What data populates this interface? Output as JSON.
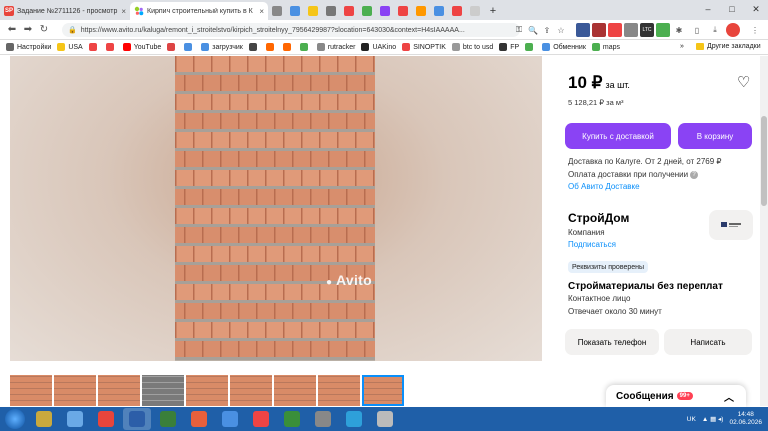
{
  "browser": {
    "tabs": [
      {
        "label": "Задание №2711126 - просмотр з",
        "favicon": "SP",
        "color": "#e8453c"
      },
      {
        "label": "Кирпич строительный купить в К",
        "favicon": "avito-icon",
        "color": "#00aaff"
      }
    ],
    "tiny_tabs": [
      "#888",
      "#4a90e2",
      "#f5c518",
      "#777",
      "#e44",
      "#4caf50",
      "#8a43f4",
      "#e44",
      "#ff9800",
      "#4a90e2",
      "#e44",
      "#ccc"
    ],
    "new_tab": "+",
    "url": "https://www.avito.ru/kaluga/remont_i_stroitelstvo/kirpich_stroitelnyy_7956429987?slocation=643030&context=H4sIAAAAA...",
    "bookmarks": [
      {
        "label": "Настройки",
        "color": "#666"
      },
      {
        "label": "USA",
        "color": "#f5c518"
      },
      {
        "label": "",
        "color": "#e44"
      },
      {
        "label": "",
        "color": "#e44"
      },
      {
        "label": "YouTube",
        "color": "#f00"
      },
      {
        "label": "",
        "color": "#d44"
      },
      {
        "label": "",
        "color": "#4a90e2"
      },
      {
        "label": "загрузчик",
        "color": "#4a90e2"
      },
      {
        "label": "",
        "color": "#444"
      },
      {
        "label": "",
        "color": "#f60"
      },
      {
        "label": "",
        "color": "#f60"
      },
      {
        "label": "",
        "color": "#4caf50"
      },
      {
        "label": "rutracker",
        "color": "#888"
      },
      {
        "label": "UAKino",
        "color": "#222"
      },
      {
        "label": "SINOPTIK",
        "color": "#e44"
      },
      {
        "label": "btc to usd",
        "color": "#999"
      },
      {
        "label": "FP",
        "color": "#333"
      },
      {
        "label": "",
        "color": "#4caf50"
      },
      {
        "label": "Обменник",
        "color": "#4a90e2"
      },
      {
        "label": "maps",
        "color": "#4caf50"
      }
    ],
    "other_bookmarks": "Другие закладки",
    "more_bookmarks": "»"
  },
  "listing": {
    "price": "10 ₽",
    "price_unit": "за шт.",
    "price_per_m3": "5 128,21 ₽ за м³",
    "buy_delivery": "Купить с доставкой",
    "add_to_cart": "В корзину",
    "delivery_line": "Доставка по Калуге. От 2 дней, от 2769 ₽",
    "payment_line": "Оплата доставки при получении",
    "about_delivery": "Об Авито Доставке",
    "seller_name": "СтройДом",
    "seller_type": "Компания",
    "subscribe": "Подписаться",
    "verified_badge": "Реквизиты проверены",
    "shop_slogan": "Стройматериалы без переплат",
    "contact_label": "Контактное лицо",
    "response_time": "Отвечает около 30 минут",
    "show_phone": "Показать телефон",
    "write": "Написать",
    "watermark": "Avito",
    "thumbnail_count": 9,
    "selected_thumbnail": 9
  },
  "messages": {
    "label": "Сообщения",
    "count": "99+"
  },
  "taskbar": {
    "lang": "UK",
    "time": "14:48",
    "date": "02.06.2026",
    "apps": [
      "#c9a93e",
      "#6aa9e6",
      "#e8453c",
      "#2c5ea8",
      "#3a7f3a",
      "#e8603c",
      "#4a90e2",
      "#e44",
      "#3a8f3a",
      "#888",
      "#2ea0da",
      "#bbb"
    ],
    "active_app_index": 3
  }
}
